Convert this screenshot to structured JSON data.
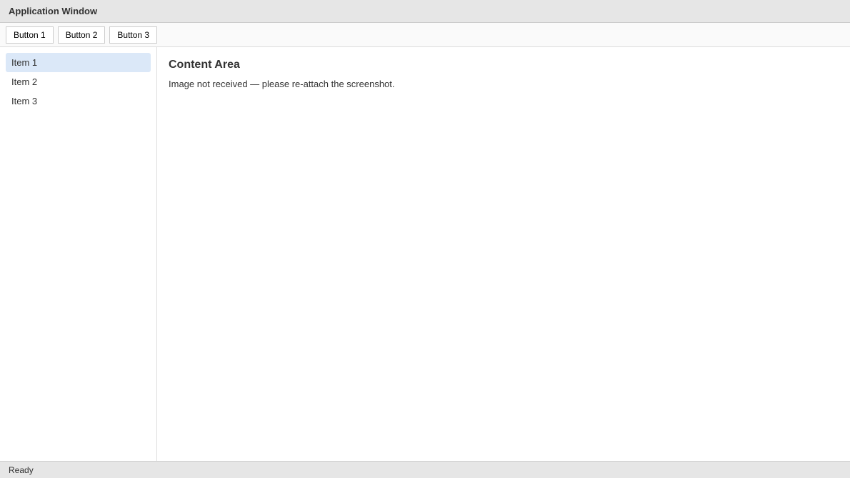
{
  "window": {
    "title": "Application Window"
  },
  "toolbar": {
    "button_1": "Button 1",
    "button_2": "Button 2",
    "button_3": "Button 3"
  },
  "sidebar": {
    "items": [
      {
        "label": "Item 1"
      },
      {
        "label": "Item 2"
      },
      {
        "label": "Item 3"
      }
    ]
  },
  "content": {
    "heading": "Content Area",
    "body": "Image not received — please re-attach the screenshot."
  },
  "status": {
    "text": "Ready"
  }
}
